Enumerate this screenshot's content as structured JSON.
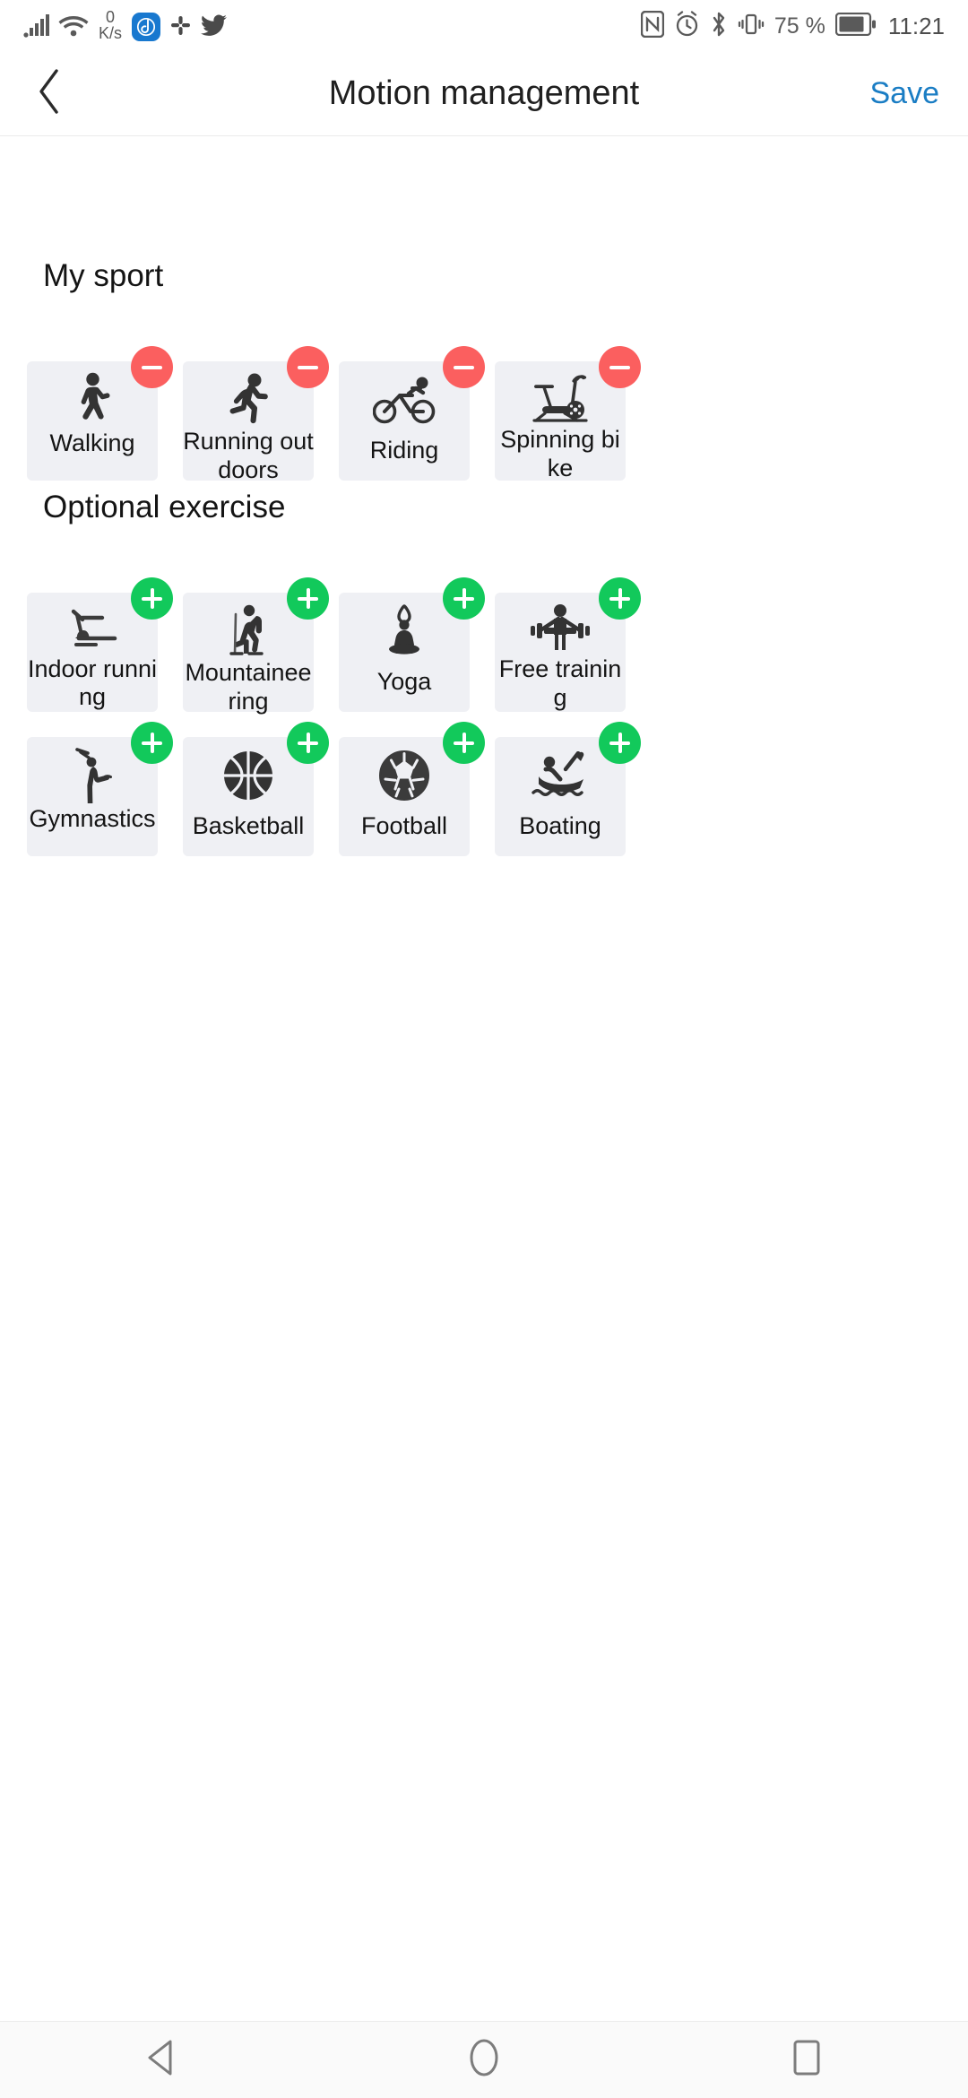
{
  "status_bar": {
    "network_speed_value": "0",
    "network_speed_unit": "K/s",
    "battery_percent": "75 %",
    "clock": "11:21",
    "icons": [
      "signal-bars-icon",
      "wifi-icon",
      "app-notification-icon",
      "slack-icon",
      "twitter-icon",
      "nfc-icon",
      "alarm-icon",
      "bluetooth-icon",
      "vibrate-icon",
      "battery-icon"
    ]
  },
  "header": {
    "back_icon": "chevron-left-icon",
    "title": "Motion management",
    "save_label": "Save"
  },
  "colors": {
    "accent_blue": "#1a7dc4",
    "badge_remove_red": "#fb5f5f",
    "badge_add_green": "#12c95b",
    "card_background": "#eff0f4"
  },
  "sections": [
    {
      "title": "My sport",
      "badge_type": "remove",
      "items": [
        {
          "label": "Walking",
          "icon": "walking-icon"
        },
        {
          "label": "Running outdoors",
          "icon": "running-icon"
        },
        {
          "label": "Riding",
          "icon": "cycling-icon"
        },
        {
          "label": "Spinning bike",
          "icon": "spinning-bike-icon"
        }
      ]
    },
    {
      "title": "Optional exercise",
      "badge_type": "add",
      "items": [
        {
          "label": "Indoor running",
          "icon": "treadmill-icon"
        },
        {
          "label": "Mountaineering",
          "icon": "hiking-icon"
        },
        {
          "label": "Yoga",
          "icon": "yoga-icon"
        },
        {
          "label": "Free training",
          "icon": "weight-lifting-icon"
        },
        {
          "label": "Gymnastics",
          "icon": "gymnastics-icon"
        },
        {
          "label": "Basketball",
          "icon": "basketball-icon"
        },
        {
          "label": "Football",
          "icon": "football-icon"
        },
        {
          "label": "Boating",
          "icon": "boating-icon"
        }
      ]
    }
  ],
  "navigation_bar": {
    "back_label": "back-triangle-icon",
    "home_label": "home-circle-icon",
    "recents_label": "recents-square-icon"
  }
}
